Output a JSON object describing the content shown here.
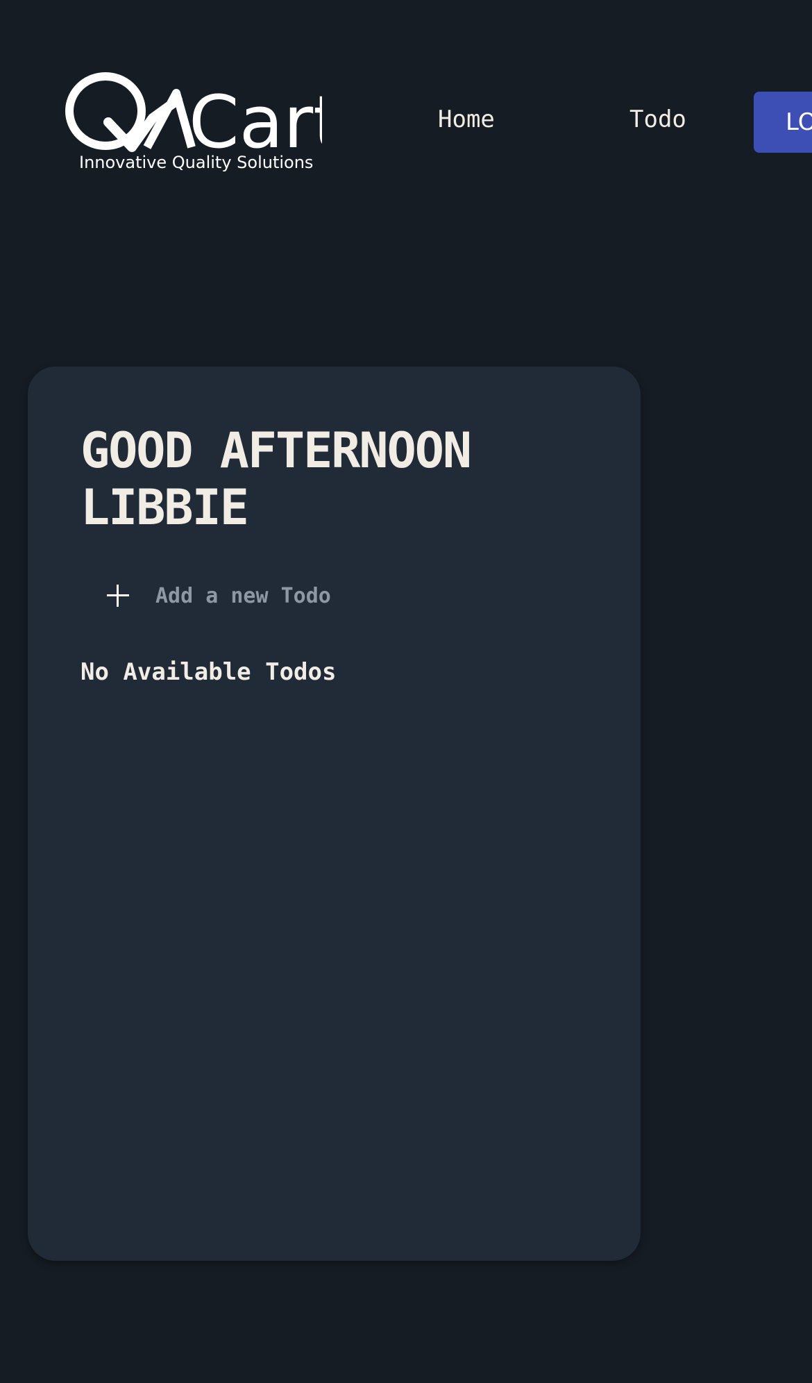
{
  "brand": {
    "logo_text": "QACart",
    "tagline": "Innovative Quality Solutions"
  },
  "nav": {
    "home_label": "Home",
    "todo_label": "Todo",
    "logout_label": "LOGOUT"
  },
  "todo_panel": {
    "greeting": "GOOD AFTERNOON LIBBIE",
    "new_todo_placeholder": "Add a new Todo",
    "new_todo_value": "",
    "empty_message": "No Available Todos"
  },
  "colors": {
    "page_background": "#161c24",
    "card_background": "#212b37",
    "accent": "#3d4fb4",
    "text": "#f1ede4",
    "placeholder": "#8e98a4"
  }
}
